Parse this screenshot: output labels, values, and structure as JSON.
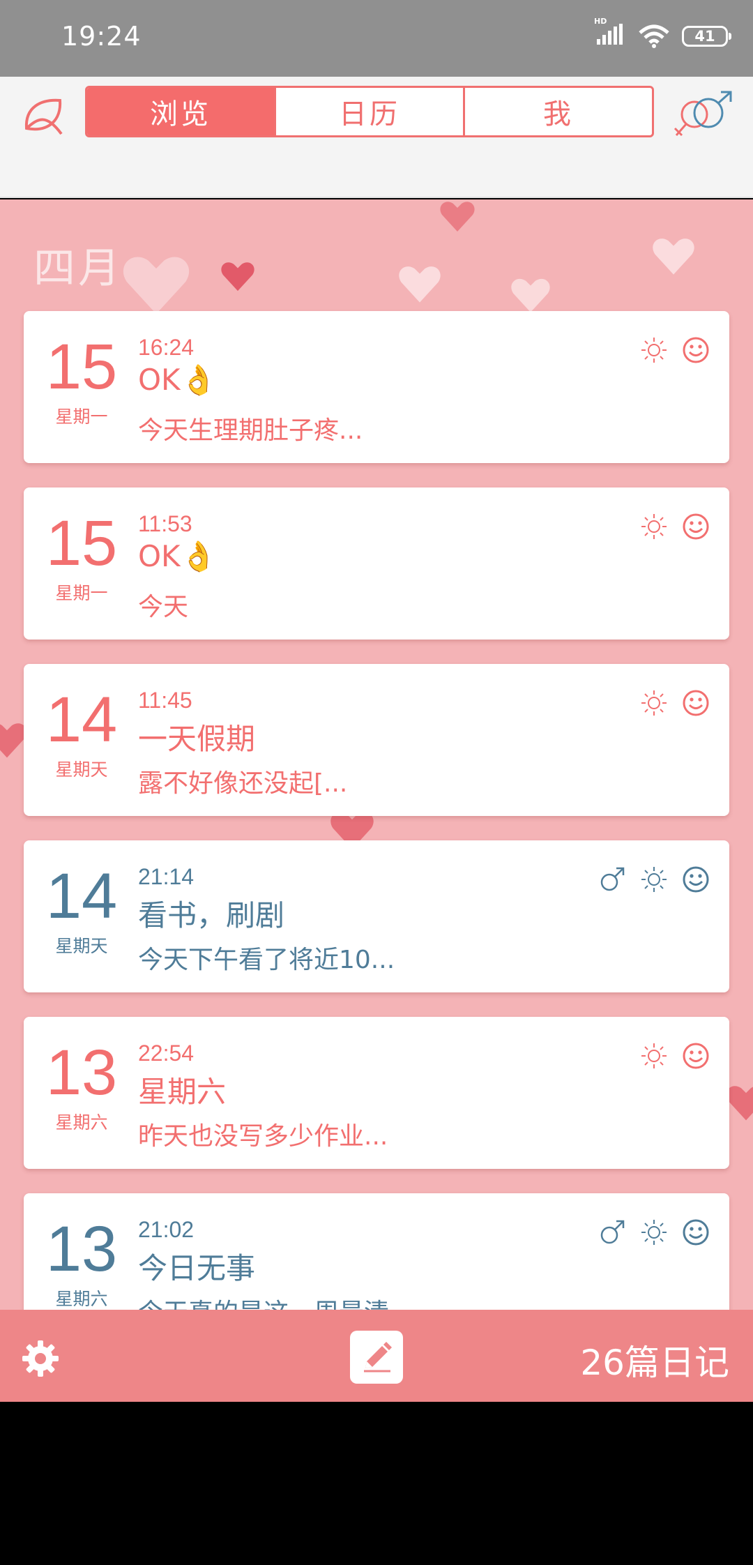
{
  "status_bar": {
    "time": "19:24",
    "battery": "41",
    "signal_label": "HD"
  },
  "header": {
    "tabs": [
      {
        "label": "浏览",
        "active": true
      },
      {
        "label": "日历",
        "active": false
      },
      {
        "label": "我",
        "active": false
      }
    ]
  },
  "feed": {
    "month": "四月",
    "entries": [
      {
        "day": "15",
        "weekday": "星期一",
        "time": "16:24",
        "title": "OK👌",
        "snippet": "今天生理期肚子疼...",
        "theme": "pink",
        "icons": [
          "sun-icon",
          "smiley-icon"
        ]
      },
      {
        "day": "15",
        "weekday": "星期一",
        "time": "11:53",
        "title": "OK👌",
        "snippet": "今天",
        "theme": "pink",
        "icons": [
          "sun-icon",
          "smiley-icon"
        ]
      },
      {
        "day": "14",
        "weekday": "星期天",
        "time": "11:45",
        "title": "一天假期",
        "snippet": "露不好像还没起[...",
        "theme": "pink",
        "icons": [
          "sun-icon",
          "smiley-icon"
        ]
      },
      {
        "day": "14",
        "weekday": "星期天",
        "time": "21:14",
        "title": "看书，刷剧",
        "snippet": "今天下午看了将近10...",
        "theme": "blue",
        "icons": [
          "male-icon",
          "sun-icon",
          "smiley-icon"
        ]
      },
      {
        "day": "13",
        "weekday": "星期六",
        "time": "22:54",
        "title": "星期六",
        "snippet": "昨天也没写多少作业...",
        "theme": "pink",
        "icons": [
          "sun-icon",
          "smiley-icon"
        ]
      },
      {
        "day": "13",
        "weekday": "星期六",
        "time": "21:02",
        "title": "今日无事",
        "snippet": "今天真的是这一周最清",
        "theme": "blue",
        "icons": [
          "male-icon",
          "sun-icon",
          "smiley-icon"
        ]
      }
    ]
  },
  "bottom_bar": {
    "count_label": "26篇日记"
  },
  "colors": {
    "pink": "#f26f6f",
    "blue": "#4f7c98",
    "feed_bg": "#f4b3b6",
    "bottom_bar": "#ee8688"
  }
}
